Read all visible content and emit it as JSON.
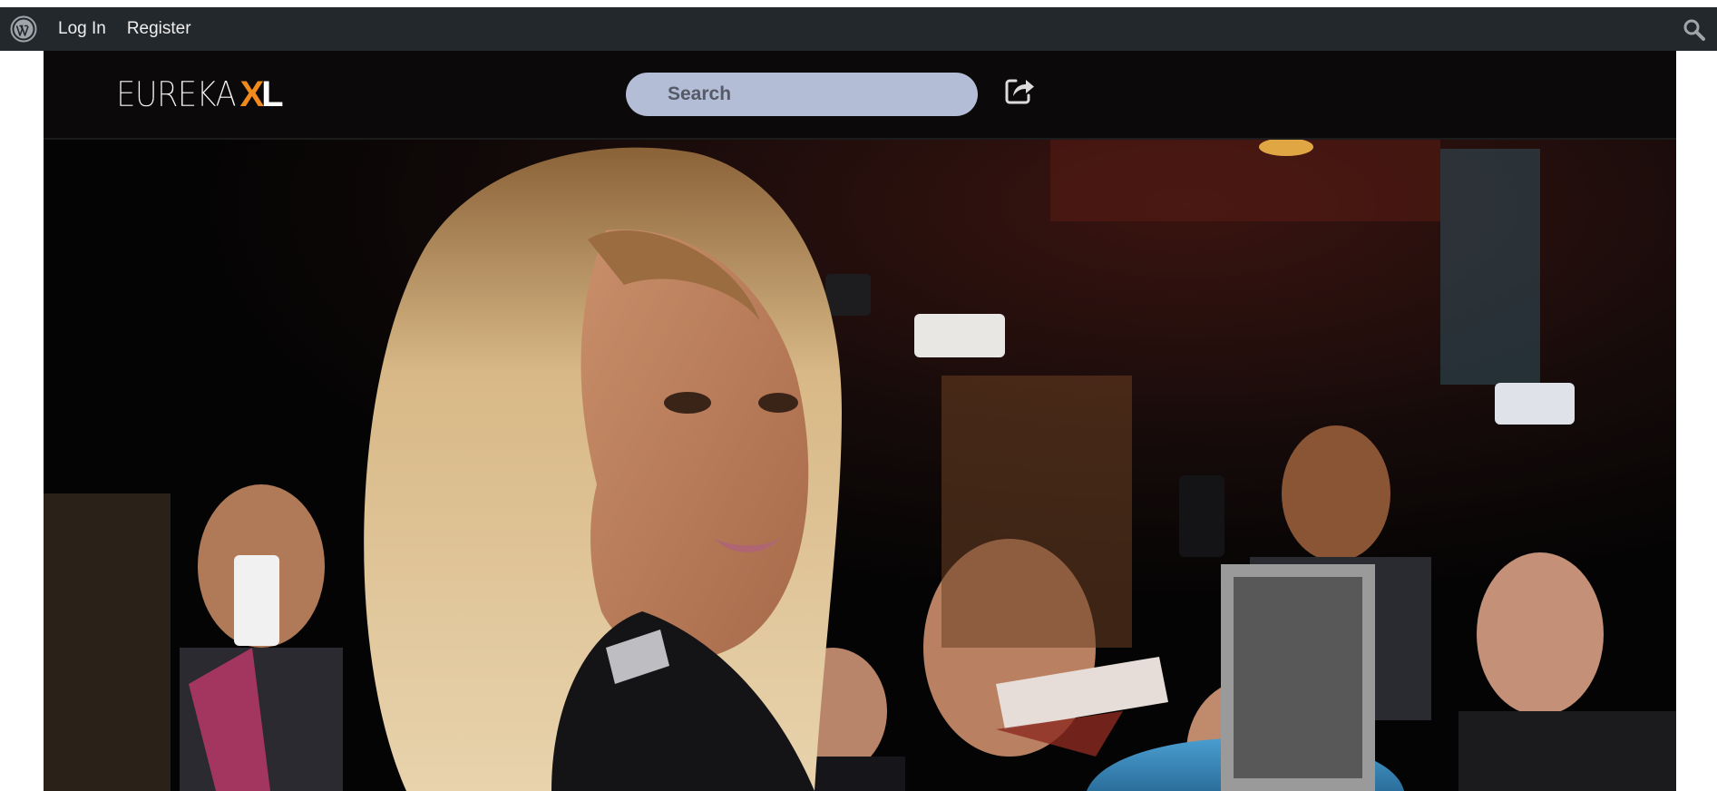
{
  "adminbar": {
    "wp_icon": "wordpress-icon",
    "login_label": "Log In",
    "register_label": "Register",
    "search_icon": "search-icon"
  },
  "header": {
    "logo_main": "EUREKA",
    "logo_x": "X",
    "logo_l": "L",
    "search_placeholder": "Search",
    "share_icon": "share-icon"
  },
  "colors": {
    "adminbar_bg": "#23282d",
    "header_bg": "#0b0909",
    "logo_accent": "#f08a1c",
    "search_bg": "#b4bdd6"
  },
  "hero": {
    "image": "celebrity-crowd-photo"
  }
}
